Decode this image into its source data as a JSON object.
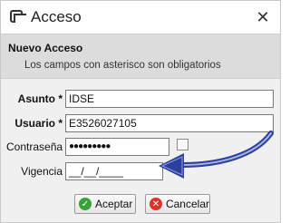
{
  "window": {
    "title": "Acceso",
    "close_label": "✕"
  },
  "header": {
    "title": "Nuevo Acceso",
    "subtitle": "Los campos con asterisco son obligatorios"
  },
  "form": {
    "asunto": {
      "label": "Asunto *",
      "value": "IDSE"
    },
    "usuario": {
      "label": "Usuario *",
      "value": "E3526027105"
    },
    "contrasena": {
      "label": "Contraseña",
      "value": "●●●●●●●●●"
    },
    "vigencia": {
      "label": "Vigencia",
      "value": "__/__/____"
    }
  },
  "buttons": {
    "accept_label": "Aceptar",
    "cancel_label": "Cancelar"
  },
  "colors": {
    "arrow": "#2a3fa0",
    "accept_icon": "#3aa23a",
    "cancel_icon": "#d8352a"
  },
  "icons": [
    "window-icon",
    "close-icon",
    "check-icon",
    "cancel-icon",
    "arrow-annotation-icon"
  ]
}
